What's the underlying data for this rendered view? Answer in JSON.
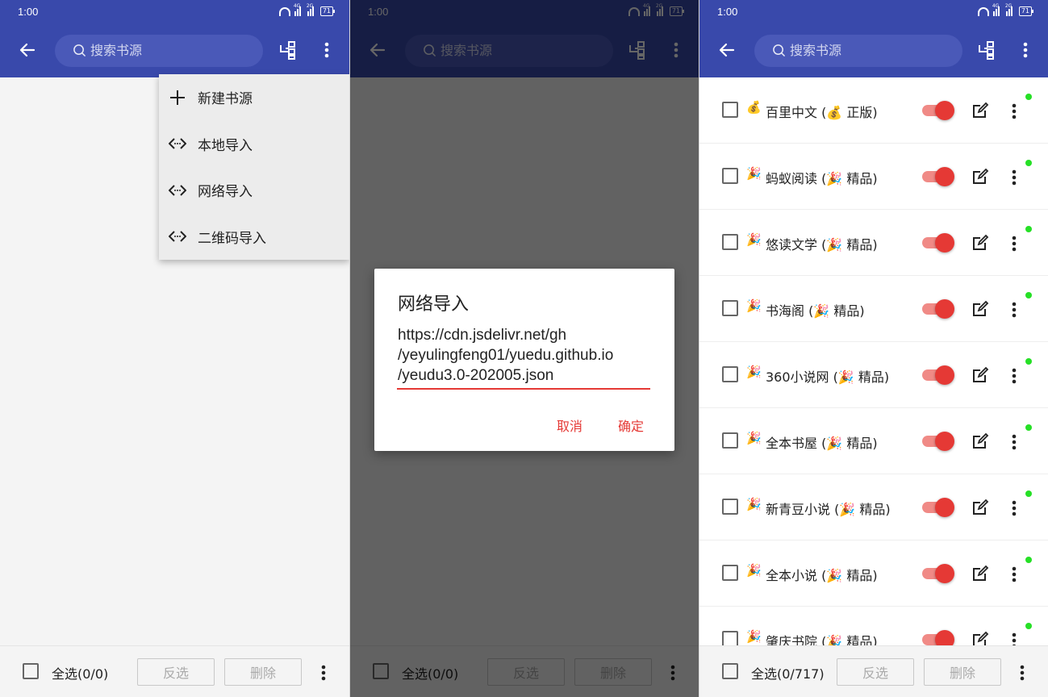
{
  "status": {
    "time": "1:00",
    "battery": "71",
    "net1": "4G",
    "net2": "2G"
  },
  "toolbar": {
    "search_placeholder": "搜索书源"
  },
  "menu": {
    "items": [
      {
        "label": "新建书源",
        "icon": "plus-icon"
      },
      {
        "label": "本地导入",
        "icon": "code-icon"
      },
      {
        "label": "网络导入",
        "icon": "code-icon"
      },
      {
        "label": "二维码导入",
        "icon": "code-icon"
      }
    ]
  },
  "dialog": {
    "title": "网络导入",
    "url_line1": "https://cdn.jsdelivr.net/gh",
    "url_line2": "/yeyulingfeng01/yuedu.github.io",
    "url_line3": "/yeudu3.0-202005.json",
    "cancel": "取消",
    "ok": "确定"
  },
  "bottombar": {
    "select_all_empty": "全选(0/0)",
    "select_all_list": "全选(0/717)",
    "invert": "反选",
    "delete": "删除"
  },
  "sources": [
    {
      "icon": "💰",
      "name": "百里中文 (💰 正版)",
      "enabled": true
    },
    {
      "icon": "🎉",
      "name": "蚂蚁阅读 (🎉 精品)",
      "enabled": true
    },
    {
      "icon": "🎉",
      "name": "悠读文学 (🎉 精品)",
      "enabled": true
    },
    {
      "icon": "🎉",
      "name": "书海阁 (🎉 精品)",
      "enabled": true
    },
    {
      "icon": "🎉",
      "name": "360小说网 (🎉 精品)",
      "enabled": true
    },
    {
      "icon": "🎉",
      "name": "全本书屋 (🎉 精品)",
      "enabled": true
    },
    {
      "icon": "🎉",
      "name": "新青豆小说 (🎉 精品)",
      "enabled": true
    },
    {
      "icon": "🎉",
      "name": "全本小说 (🎉 精品)",
      "enabled": true
    },
    {
      "icon": "🎉",
      "name": "肇庆书院 (🎉 精品)",
      "enabled": true
    }
  ],
  "colors": {
    "primary": "#3949ab",
    "accent": "#e53935",
    "status_dot": "#26e026"
  }
}
